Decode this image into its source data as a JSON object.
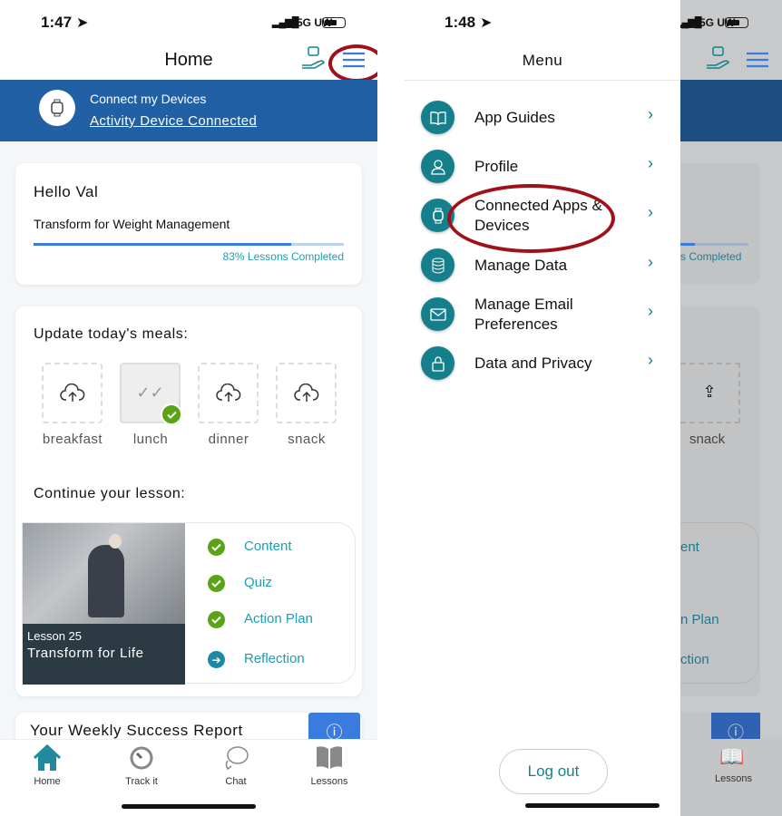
{
  "left": {
    "status": {
      "time": "1:47",
      "network": "5G UW"
    },
    "header": {
      "title": "Home"
    },
    "banner": {
      "title": "Connect my Devices",
      "link": "Activity Device Connected"
    },
    "greeting": {
      "hello": "Hello Val",
      "program": "Transform for Weight Management",
      "progress_percent": 83,
      "progress_label": "83% Lessons Completed"
    },
    "meals": {
      "title": "Update today's meals:",
      "items": [
        {
          "label": "breakfast",
          "done": false
        },
        {
          "label": "lunch",
          "done": true
        },
        {
          "label": "dinner",
          "done": false
        },
        {
          "label": "snack",
          "done": false
        }
      ]
    },
    "lesson": {
      "title": "Continue your lesson:",
      "number": "Lesson 25",
      "name": "Transform for Life",
      "steps": [
        {
          "label": "Content",
          "status": "complete"
        },
        {
          "label": "Quiz",
          "status": "complete"
        },
        {
          "label": "Action Plan",
          "status": "complete"
        },
        {
          "label": "Reflection",
          "status": "next"
        }
      ]
    },
    "report": {
      "title": "Your Weekly Success Report"
    },
    "tabs": [
      {
        "label": "Home",
        "icon": "home-icon"
      },
      {
        "label": "Track it",
        "icon": "stopwatch-icon"
      },
      {
        "label": "Chat",
        "icon": "chat-icon"
      },
      {
        "label": "Lessons",
        "icon": "book-icon"
      }
    ]
  },
  "right": {
    "status": {
      "time": "1:48",
      "network": "5G UW"
    },
    "menu": {
      "title": "Menu",
      "items": [
        {
          "label": "App Guides",
          "icon": "book-icon"
        },
        {
          "label": "Profile",
          "icon": "user-icon"
        },
        {
          "label": "Connected Apps & Devices",
          "icon": "watch-icon"
        },
        {
          "label": "Manage Data",
          "icon": "database-icon"
        },
        {
          "label": "Manage Email Preferences",
          "icon": "mail-icon"
        },
        {
          "label": "Data and Privacy",
          "icon": "lock-icon"
        }
      ],
      "logout": "Log out"
    },
    "behind": {
      "progress_fragment": "s Completed",
      "meal_fragment": "snack",
      "step_fragments": [
        "ent",
        "n Plan",
        "ction"
      ],
      "tab": "Lessons"
    }
  },
  "colors": {
    "primary_blue": "#2160a5",
    "teal": "#15808c",
    "accent_link": "#1e9db3",
    "check_green": "#5aa317",
    "annotation_red": "#a0101a"
  }
}
